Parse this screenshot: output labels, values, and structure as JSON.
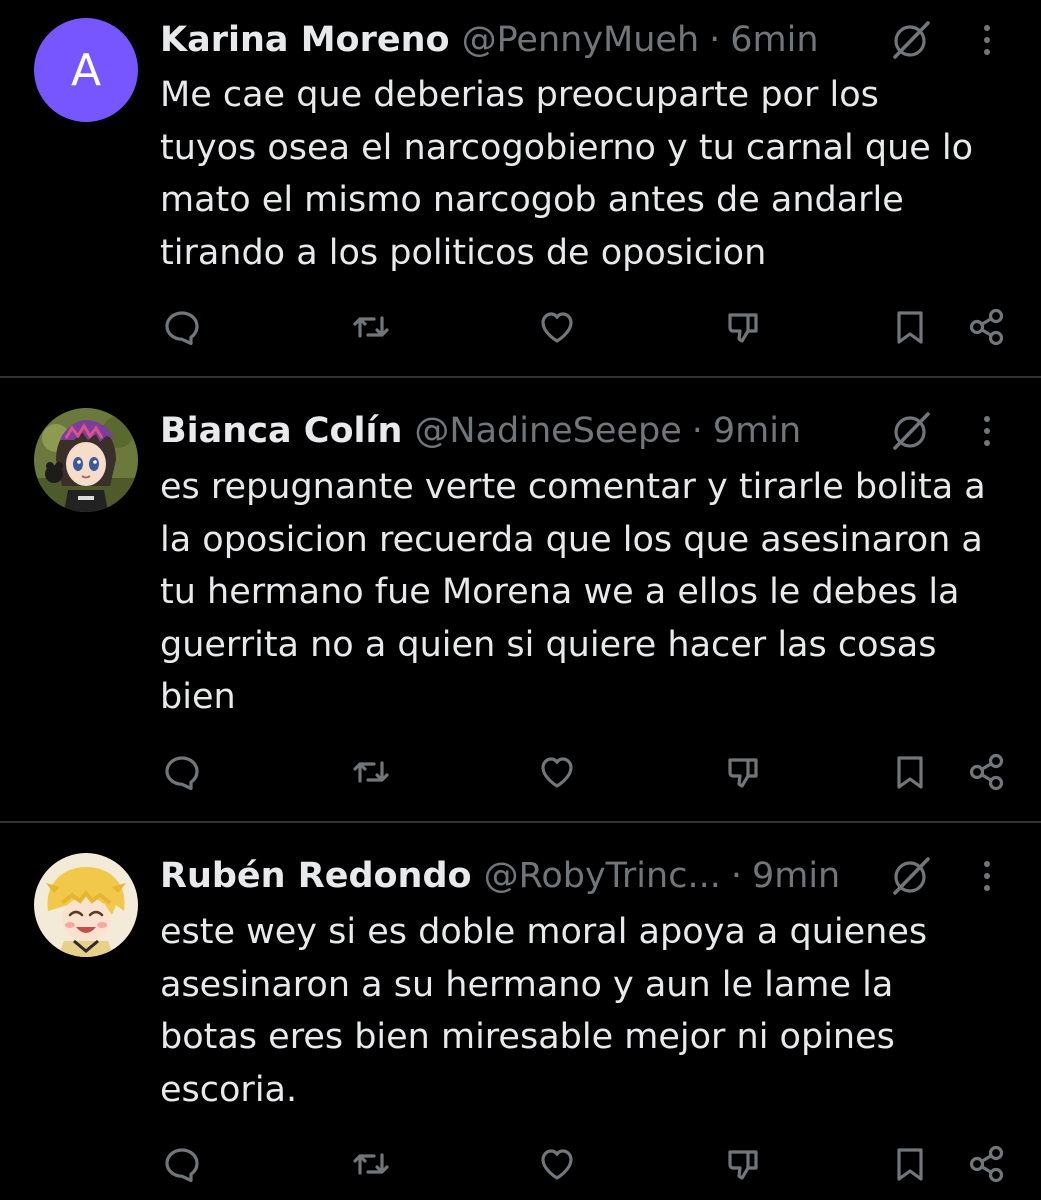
{
  "tweets": [
    {
      "display_name": "Karina Moreno",
      "handle": "@PennyMueh",
      "separator": "·",
      "time": "6min",
      "avatar_letter": "A",
      "avatar_color": "#7856ff",
      "text": "Me cae que deberias preocuparte por los\ntuyos osea el narcogobierno y tu carnal que lo\nmato el mismo narcogob antes de andarle\ntirando a los politicos de oposicion"
    },
    {
      "display_name": "Bianca Colín",
      "handle": "@NadineSeepe",
      "separator": "·",
      "time": "9min",
      "avatar_icon": "anime-girl-avatar",
      "text": "es repugnante verte comentar y tirarle bolita a\nla oposicion recuerda que los que asesinaron a\ntu hermano fue Morena we a ellos le debes la\nguerrita no a quien si quiere hacer las cosas\nbien"
    },
    {
      "display_name": "Rubén Redondo",
      "handle": "@RobyTrinc...",
      "separator": "·",
      "time": "9min",
      "avatar_icon": "anime-blonde-boy-avatar",
      "text": "este wey si es doble moral apoya a quienes\nasesinaron a su hermano y aun le lame la\nbotas eres bien miresable mejor ni opines\nescoria."
    }
  ],
  "icons": {
    "reply": "reply-icon",
    "repost": "repost-icon",
    "like": "like-icon",
    "downvote": "downvote-icon",
    "bookmark": "bookmark-icon",
    "share": "share-icon",
    "grok": "grok-icon",
    "more": "more-icon"
  },
  "colors": {
    "background": "#000000",
    "text": "#e7e9ea",
    "secondary_text": "#71767b",
    "divider": "#2f3336"
  }
}
